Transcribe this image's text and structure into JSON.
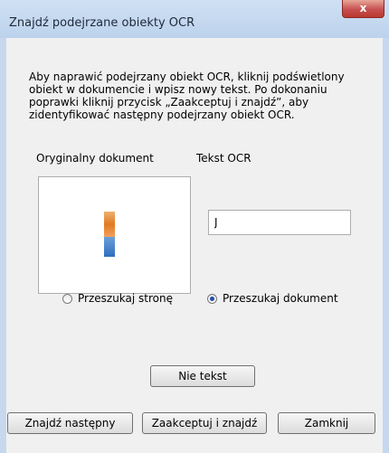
{
  "window": {
    "title": "Znajdź podejrzane obiekty OCR",
    "close_glyph": "x"
  },
  "instructions": "Aby naprawić podejrzany obiekt OCR, kliknij podświetlony obiekt w dokumencie i wpisz nowy tekst. Po dokonaniu poprawki kliknij przycisk „Zaakceptuj i znajdź”, aby zidentyfikować następny podejrzany obiekt OCR.",
  "labels": {
    "original_document": "Oryginalny dokument",
    "ocr_text": "Tekst OCR"
  },
  "ocr_input": {
    "value": "J"
  },
  "search_scope": {
    "options": [
      {
        "label": "Przeszukaj stronę",
        "selected": false
      },
      {
        "label": "Przeszukaj dokument",
        "selected": true
      }
    ]
  },
  "buttons": {
    "not_text": "Nie tekst",
    "find_next": "Znajdź następny",
    "accept_and_find": "Zaakceptuj i znajdź",
    "close": "Zamknij"
  },
  "colors": {
    "titlebar": "#c8dbf2",
    "close_button": "#c75050",
    "dialog_background": "#f0f0f0",
    "radio_selected": "#1f4fa8"
  },
  "icons": {
    "close": "close-icon",
    "radio_unchecked": "radio-unchecked-icon",
    "radio_checked": "radio-checked-icon"
  }
}
